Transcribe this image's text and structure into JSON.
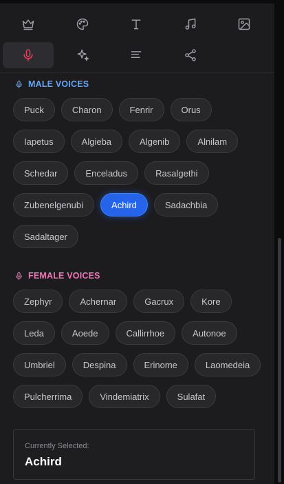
{
  "toolbar": {
    "tools": [
      {
        "icon": "crown-icon",
        "active": false
      },
      {
        "icon": "palette-icon",
        "active": false
      },
      {
        "icon": "text-icon",
        "active": false
      },
      {
        "icon": "music-icon",
        "active": false
      },
      {
        "icon": "image-icon",
        "active": false
      },
      {
        "icon": "microphone-icon",
        "active": true
      },
      {
        "icon": "sparkles-icon",
        "active": false
      },
      {
        "icon": "align-left-icon",
        "active": false
      },
      {
        "icon": "share-icon",
        "active": false
      }
    ]
  },
  "male": {
    "title": "MALE VOICES",
    "rows": [
      [
        "Puck",
        "Charon",
        "Fenrir",
        "Orus"
      ],
      [
        "Iapetus",
        "Algieba",
        "Algenib",
        "Alnilam"
      ],
      [
        "Schedar",
        "Enceladus",
        "Rasalgethi"
      ],
      [
        "Zubenelgenubi",
        "Achird",
        "Sadachbia"
      ],
      [
        "Sadaltager"
      ]
    ]
  },
  "female": {
    "title": "FEMALE VOICES",
    "rows": [
      [
        "Zephyr",
        "Achernar",
        "Gacrux",
        "Kore"
      ],
      [
        "Leda",
        "Aoede",
        "Callirrhoe",
        "Autonoe"
      ],
      [
        "Umbriel",
        "Despina",
        "Erinome",
        "Laomedeia"
      ],
      [
        "Pulcherrima",
        "Vindemiatrix",
        "Sulafat"
      ]
    ]
  },
  "current": {
    "label": "Currently Selected:",
    "value": "Achird"
  },
  "colors": {
    "accent": "#2563eb",
    "male": "#60a5fa",
    "female": "#f472b6",
    "active_tool": "#f43f5e"
  }
}
